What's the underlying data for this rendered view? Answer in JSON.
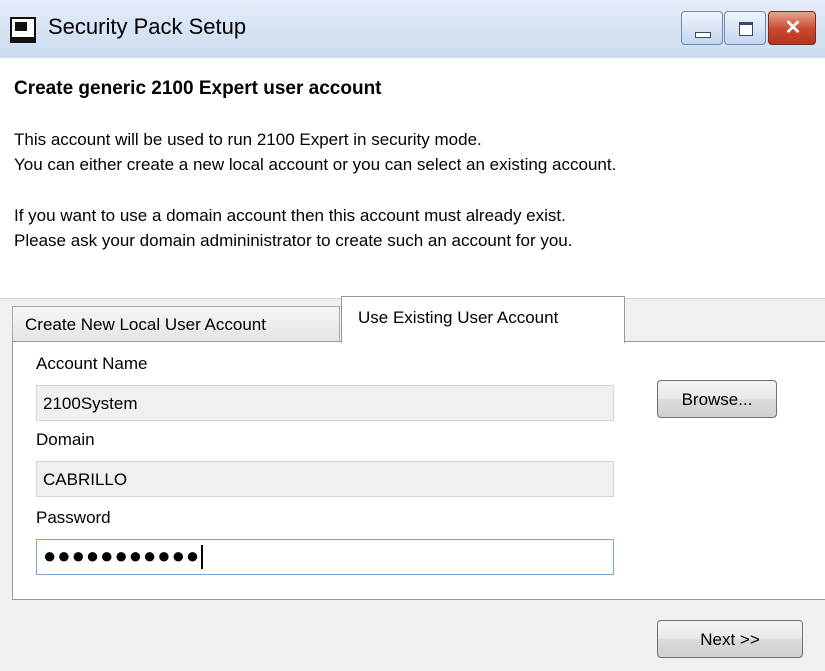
{
  "window": {
    "title": "Security Pack Setup",
    "close_glyph": "✕"
  },
  "header": {
    "heading": "Create generic 2100 Expert user account",
    "lines": [
      "This account will be used to run 2100 Expert in security mode.",
      "You can either create a new local account or you can select an existing account.",
      "If you want to use a domain account then this account must already exist.",
      "Please ask your domain admininistrator to create such an account for you."
    ]
  },
  "tabs": [
    {
      "label": "Create New Local User Account",
      "active": false
    },
    {
      "label": "Use Existing User Account",
      "active": true
    }
  ],
  "form": {
    "account_name_label": "Account Name",
    "account_name_value": "2100System",
    "browse_label": "Browse...",
    "domain_label": "Domain",
    "domain_value": "CABRILLO",
    "password_label": "Password",
    "password_masked": "●●●●●●●●●●●"
  },
  "footer": {
    "next_label": "Next >>"
  },
  "icons": {
    "app": "setup-app-icon",
    "minimize": "minimize-icon",
    "maximize": "maximize-icon",
    "close": "close-icon"
  },
  "colors": {
    "titlebar": "#d7e4f5",
    "close_button": "#c9462c",
    "focus_border": "#7aa7d8"
  }
}
